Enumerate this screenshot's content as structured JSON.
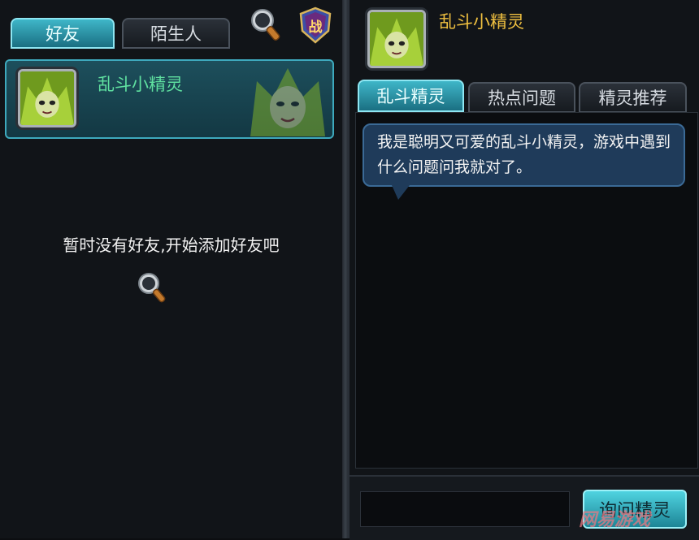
{
  "left": {
    "tabs": [
      {
        "label": "好友",
        "active": true
      },
      {
        "label": "陌生人",
        "active": false
      }
    ],
    "friend": {
      "name": "乱斗小精灵"
    },
    "empty_message": "暂时没有好友,开始添加好友吧"
  },
  "right": {
    "header_name": "乱斗小精灵",
    "tabs": [
      {
        "label": "乱斗精灵",
        "active": true
      },
      {
        "label": "热点问题",
        "active": false
      },
      {
        "label": "精灵推荐",
        "active": false
      }
    ],
    "message": "我是聪明又可爱的乱斗小精灵，游戏中遇到什么问题问我就对了。",
    "ask_button": "询问精灵",
    "battle_badge": "战"
  },
  "watermark": "网易游戏",
  "colors": {
    "accent": "#3fb6c8",
    "name_green": "#5fe0a0",
    "name_gold": "#f0c040",
    "bubble": "#1f3b5a"
  }
}
